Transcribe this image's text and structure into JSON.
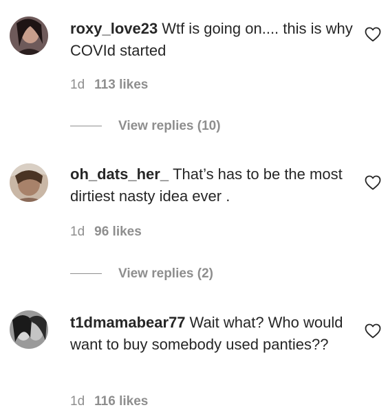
{
  "comments": [
    {
      "username": "roxy_love23",
      "text": "Wtf is going on.... this is why COVId started",
      "age": "1d",
      "likes": "113 likes",
      "view_replies": "View replies (10)"
    },
    {
      "username": "oh_dats_her_",
      "text": "That’s has to be the most dirtiest nasty idea ever .",
      "age": "1d",
      "likes": "96 likes",
      "view_replies": "View replies (2)"
    },
    {
      "username": "t1dmamabear77",
      "text": "Wait what? Who would want to buy somebody used panties??",
      "age": "1d",
      "likes": "116 likes"
    }
  ],
  "icons": {
    "like": "heart-outline-icon"
  },
  "colors": {
    "text": "#262626",
    "secondary": "#8e8e8e",
    "background": "#ffffff"
  }
}
